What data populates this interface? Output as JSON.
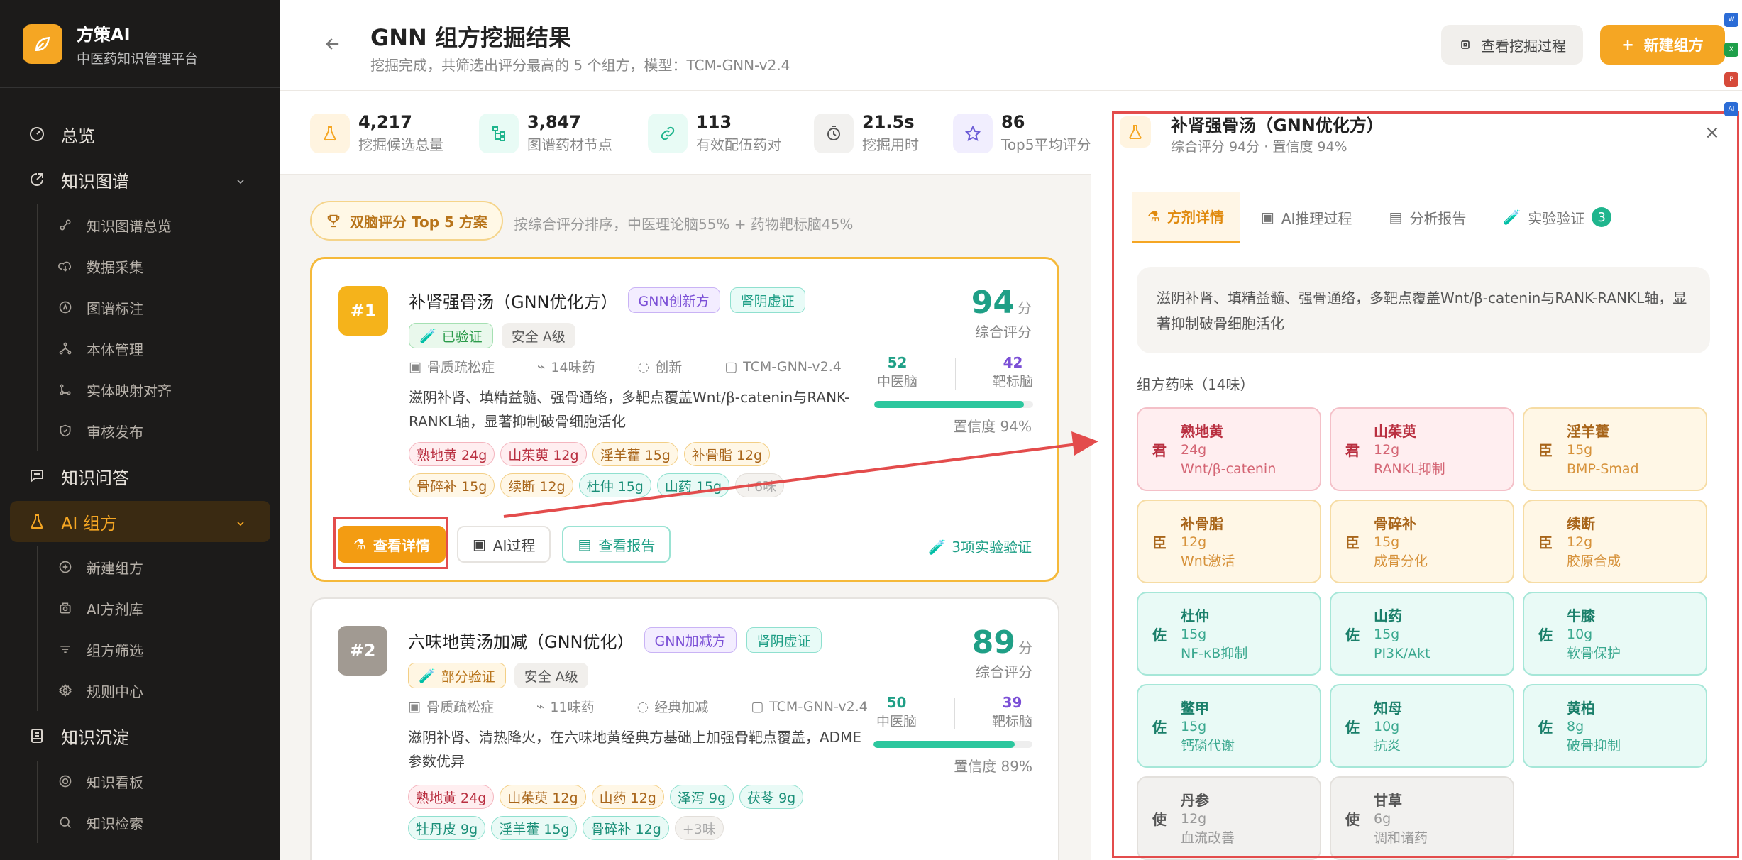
{
  "brand": {
    "name": "方策AI",
    "subtitle": "中医药知识管理平台"
  },
  "nav": {
    "overview": "总览",
    "kg": "知识图谱",
    "kg_items": [
      "知识图谱总览",
      "数据采集",
      "图谱标注",
      "本体管理",
      "实体映射对齐",
      "审核发布"
    ],
    "qa": "知识问答",
    "ai": "AI 组方",
    "ai_items": [
      "新建组方",
      "AI方剂库",
      "组方筛选",
      "规则中心"
    ],
    "depo": "知识沉淀",
    "depo_items": [
      "知识看板",
      "知识检索"
    ]
  },
  "header": {
    "title": "GNN 组方挖掘结果",
    "subtitle": "挖掘完成，共筛选出评分最高的 5 个组方，模型：TCM-GNN-v2.4",
    "btn_process": "查看挖掘过程",
    "btn_new": "新建组方"
  },
  "stats": [
    {
      "value": "4,217",
      "label": "挖掘候选总量"
    },
    {
      "value": "3,847",
      "label": "图谱药材节点"
    },
    {
      "value": "113",
      "label": "有效配伍药对"
    },
    {
      "value": "21.5s",
      "label": "挖掘用时"
    },
    {
      "value": "86",
      "label": "Top5平均评分"
    }
  ],
  "top5": {
    "label": "双脑评分 Top 5 方案",
    "note": "按综合评分排序，中医理论脑55% + 药物靶标脑45%"
  },
  "cards": [
    {
      "rank": "#1",
      "title": "补肾强骨汤（GNN优化方）",
      "tags": [
        "GNN创新方",
        "肾阴虚证"
      ],
      "verify_badge": "已验证",
      "safety": "安全 A级",
      "meta": [
        "骨质疏松症",
        "14味药",
        "创新",
        "TCM-GNN-v2.4"
      ],
      "desc": "滋阴补肾、填精益髓、强骨通络，多靶点覆盖Wnt/β-catenin与RANK-RANKL轴，显著抑制破骨细胞活化",
      "herbs": [
        {
          "name": "熟地黄 24g",
          "tone": "red"
        },
        {
          "name": "山茱萸 12g",
          "tone": "red"
        },
        {
          "name": "淫羊藿 15g",
          "tone": "amber"
        },
        {
          "name": "补骨脂 12g",
          "tone": "amber"
        },
        {
          "name": "骨碎补 15g",
          "tone": "amber"
        },
        {
          "name": "续断 12g",
          "tone": "amber"
        },
        {
          "name": "杜仲 15g",
          "tone": "teal"
        },
        {
          "name": "山药 15g",
          "tone": "teal"
        },
        {
          "name": "+6味",
          "tone": "more"
        }
      ],
      "score": "94",
      "score_unit": "分",
      "score_label": "综合评分",
      "tcm": "52",
      "tcm_label": "中医脑",
      "target": "42",
      "target_label": "靶标脑",
      "confidence": 0.94,
      "confidence_text": "置信度 94%",
      "actions": [
        "查看详情",
        "AI过程",
        "查看报告"
      ],
      "experiments": "3项实验验证"
    },
    {
      "rank": "#2",
      "title": "六味地黄汤加减（GNN优化）",
      "tags": [
        "GNN加减方",
        "肾阴虚证"
      ],
      "verify_badge": "部分验证",
      "safety": "安全 A级",
      "meta": [
        "骨质疏松症",
        "11味药",
        "经典加减",
        "TCM-GNN-v2.4"
      ],
      "desc": "滋阴补肾、清热降火，在六味地黄经典方基础上加强骨靶点覆盖，ADME参数优异",
      "herbs": [
        {
          "name": "熟地黄 24g",
          "tone": "red"
        },
        {
          "name": "山茱萸 12g",
          "tone": "amber"
        },
        {
          "name": "山药 12g",
          "tone": "amber"
        },
        {
          "name": "泽泻 9g",
          "tone": "teal"
        },
        {
          "name": "茯苓 9g",
          "tone": "teal"
        },
        {
          "name": "牡丹皮 9g",
          "tone": "teal"
        },
        {
          "name": "淫羊藿 15g",
          "tone": "teal"
        },
        {
          "name": "骨碎补 12g",
          "tone": "teal"
        },
        {
          "name": "+3味",
          "tone": "more"
        }
      ],
      "score": "89",
      "score_unit": "分",
      "score_label": "综合评分",
      "tcm": "50",
      "tcm_label": "中医脑",
      "target": "39",
      "target_label": "靶标脑",
      "confidence": 0.89,
      "confidence_text": "置信度 89%"
    }
  ],
  "panel": {
    "title": "补肾强骨汤（GNN优化方）",
    "sub": "综合评分 94分 · 置信度 94%",
    "close": "×",
    "tabs": [
      "方剂详情",
      "AI推理过程",
      "分析报告",
      "实验验证"
    ],
    "exp_count": "3",
    "desc": "滋阴补肾、填精益髓、强骨通络，多靶点覆盖Wnt/β-catenin与RANK-RANKL轴，显著抑制破骨细胞活化",
    "herbs_label": "组方药味（14味）",
    "herbs": [
      {
        "role": "君",
        "name": "熟地黄",
        "dose": "24g",
        "effect": "Wnt/β-catenin",
        "tone": "red"
      },
      {
        "role": "君",
        "name": "山茱萸",
        "dose": "12g",
        "effect": "RANKL抑制",
        "tone": "red"
      },
      {
        "role": "臣",
        "name": "淫羊藿",
        "dose": "15g",
        "effect": "BMP-Smad",
        "tone": "amber"
      },
      {
        "role": "臣",
        "name": "补骨脂",
        "dose": "12g",
        "effect": "Wnt激活",
        "tone": "amber"
      },
      {
        "role": "臣",
        "name": "骨碎补",
        "dose": "15g",
        "effect": "成骨分化",
        "tone": "amber"
      },
      {
        "role": "臣",
        "name": "续断",
        "dose": "12g",
        "effect": "胶原合成",
        "tone": "amber"
      },
      {
        "role": "佐",
        "name": "杜仲",
        "dose": "15g",
        "effect": "NF-κB抑制",
        "tone": "teal"
      },
      {
        "role": "佐",
        "name": "山药",
        "dose": "15g",
        "effect": "PI3K/Akt",
        "tone": "teal"
      },
      {
        "role": "佐",
        "name": "牛膝",
        "dose": "10g",
        "effect": "软骨保护",
        "tone": "teal"
      },
      {
        "role": "佐",
        "name": "鳖甲",
        "dose": "15g",
        "effect": "钙磷代谢",
        "tone": "teal"
      },
      {
        "role": "佐",
        "name": "知母",
        "dose": "10g",
        "effect": "抗炎",
        "tone": "teal"
      },
      {
        "role": "佐",
        "name": "黄柏",
        "dose": "8g",
        "effect": "破骨抑制",
        "tone": "teal"
      },
      {
        "role": "使",
        "name": "丹参",
        "dose": "12g",
        "effect": "血流改善",
        "tone": "gray"
      },
      {
        "role": "使",
        "name": "甘草",
        "dose": "6g",
        "effect": "调和诸药",
        "tone": "gray"
      }
    ]
  },
  "right_rail": {
    "ai_label": "AI"
  },
  "colors": {
    "accent": "#f5a623",
    "teal": "#1f9f86",
    "purple": "#7b4fd6",
    "highlight": "#e34c4c"
  }
}
